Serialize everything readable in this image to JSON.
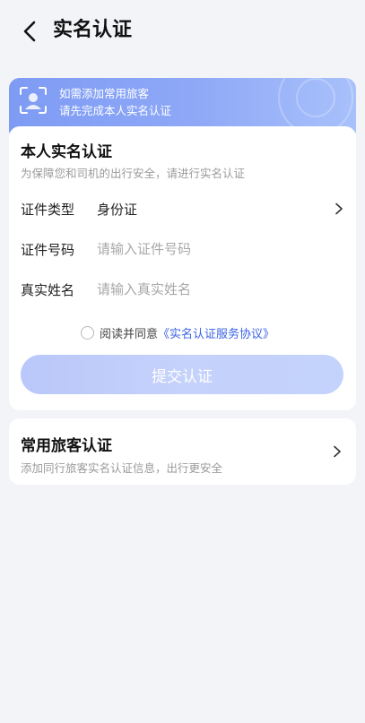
{
  "header": {
    "title": "实名认证",
    "back_icon": "chevron-left-icon"
  },
  "banner": {
    "line1": "如需添加常用旅客",
    "line2": "请先完成本人实名认证",
    "icon": "id-scan-icon"
  },
  "verification": {
    "title": "本人实名认证",
    "subtitle": "为保障您和司机的出行安全，请进行实名认证",
    "id_type_label": "证件类型",
    "id_type_value": "身份证",
    "id_number_label": "证件号码",
    "id_number_placeholder": "请输入证件号码",
    "name_label": "真实姓名",
    "name_placeholder": "请输入真实姓名",
    "agree_text": "阅读并同意",
    "agree_link": "《实名认证服务协议》",
    "submit_label": "提交认证",
    "submit_color": "#b9c7fa"
  },
  "traveler": {
    "title": "常用旅客认证",
    "subtitle": "添加同行旅客实名认证信息，出行更安全"
  },
  "colors": {
    "accent": "#3b63e4",
    "banner": "#8fa9f7",
    "background": "#f3f4f8"
  }
}
